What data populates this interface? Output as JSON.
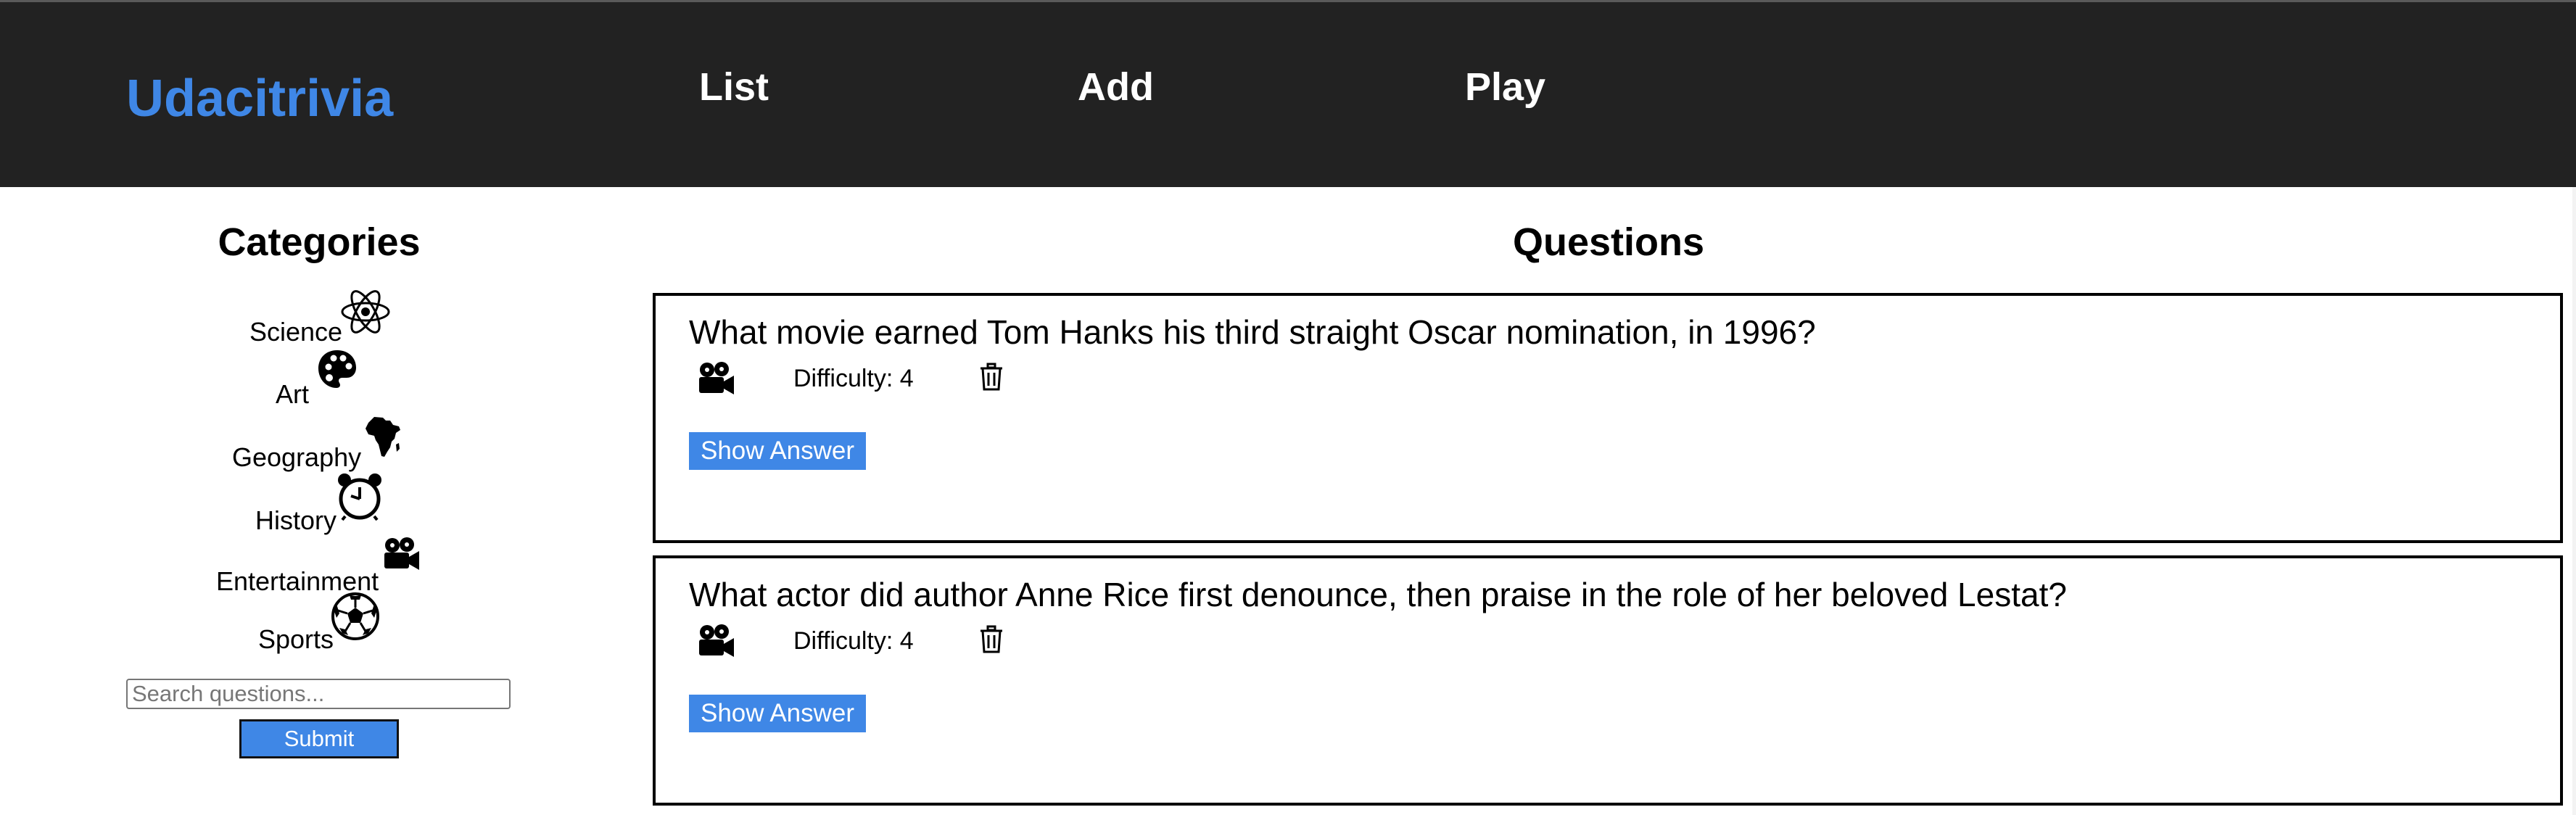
{
  "app": {
    "brand": "Udacitrivia",
    "nav": {
      "list": "List",
      "add": "Add",
      "play": "Play"
    },
    "accent_color": "#3f87e6",
    "header_bg": "#222222"
  },
  "sidebar": {
    "title": "Categories",
    "categories": [
      {
        "label": "Science",
        "icon": "atom-icon"
      },
      {
        "label": "Art",
        "icon": "palette-icon"
      },
      {
        "label": "Geography",
        "icon": "africa-map-icon"
      },
      {
        "label": "History",
        "icon": "alarm-clock-icon"
      },
      {
        "label": "Entertainment",
        "icon": "film-camera-icon"
      },
      {
        "label": "Sports",
        "icon": "soccer-ball-icon"
      }
    ],
    "search": {
      "placeholder": "Search questions...",
      "value": ""
    },
    "submit_label": "Submit"
  },
  "main": {
    "title": "Questions",
    "questions": [
      {
        "text": "What movie earned Tom Hanks his third straight Oscar nomination, in 1996?",
        "category_icon": "film-camera-icon",
        "difficulty": "Difficulty: 4",
        "show_answer": "Show Answer"
      },
      {
        "text": "What actor did author Anne Rice first denounce, then praise in the role of her beloved Lestat?",
        "category_icon": "film-camera-icon",
        "difficulty": "Difficulty: 4",
        "show_answer": "Show Answer"
      }
    ]
  }
}
